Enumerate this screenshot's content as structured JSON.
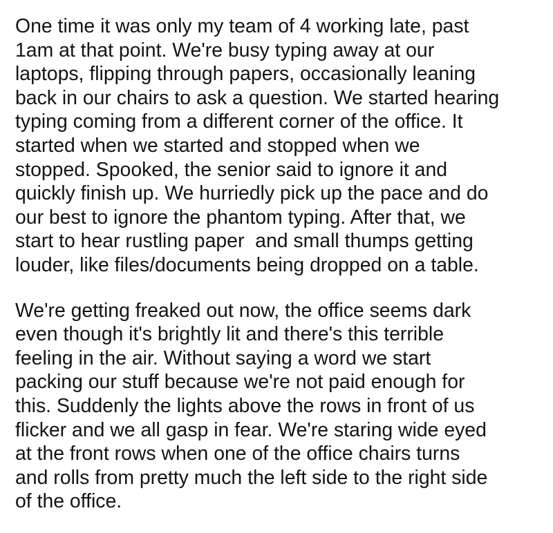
{
  "post": {
    "paragraphs": [
      {
        "lines": [
          "One time it was only my team of 4 working late, past",
          "1am at that point. We're busy typing away at our",
          "laptops, flipping through papers, occasionally leaning",
          "back in our chairs to ask a question. We started hearing",
          "typing coming from a different corner of the office. It",
          "started when we started and stopped when we",
          "stopped. Spooked, the senior said to ignore it and",
          "quickly finish up. We hurriedly pick up the pace and do",
          "our best to ignore the phantom typing. After that, we",
          "start to hear rustling paper  and small thumps getting",
          "louder, like files/documents being dropped on a table."
        ]
      },
      {
        "lines": [
          "We're getting freaked out now, the office seems dark",
          "even though it's brightly lit and there's this terrible",
          "feeling in the air. Without saying a word we start",
          "packing our stuff because we're not paid enough for",
          "this. Suddenly the lights above the rows in front of us",
          "flicker and we all gasp in fear. We're staring wide eyed",
          "at the front rows when one of the office chairs turns",
          "and rolls from pretty much the left side to the right side",
          "of the office."
        ]
      }
    ]
  }
}
